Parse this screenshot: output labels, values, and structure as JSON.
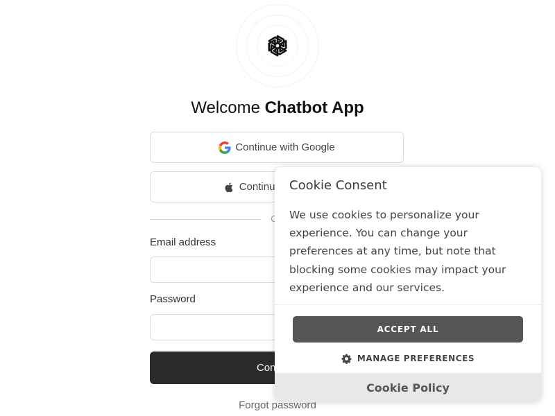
{
  "logo": {
    "icon": "openai-knot-icon"
  },
  "heading": {
    "prefix": "Welcome",
    "app_name": "Chatbot App"
  },
  "oauth": {
    "google_label": "Continue with Google",
    "google_icon": "google-g-icon",
    "apple_label": "Continue with Apple",
    "apple_icon": "apple-icon"
  },
  "divider": {
    "text": "OR"
  },
  "form": {
    "email_label": "Email address",
    "email_value": "",
    "password_label": "Password",
    "password_value": "",
    "continue_label": "Continue",
    "forgot_label": "Forgot password"
  },
  "cookie": {
    "title": "Cookie Consent",
    "body": "We use cookies to personalize your experience. You can change your preferences at any time, but note that blocking some cookies may impact your experience and our services.",
    "accept_label": "ACCEPT ALL",
    "manage_label": "MANAGE PREFERENCES",
    "manage_icon": "gear-icon",
    "policy_label": "Cookie Policy"
  },
  "colors": {
    "primary_button": "#2b2b2b",
    "accept_button": "#555555",
    "policy_bar": "#e8e8e8",
    "border": "#dcdcdc"
  }
}
